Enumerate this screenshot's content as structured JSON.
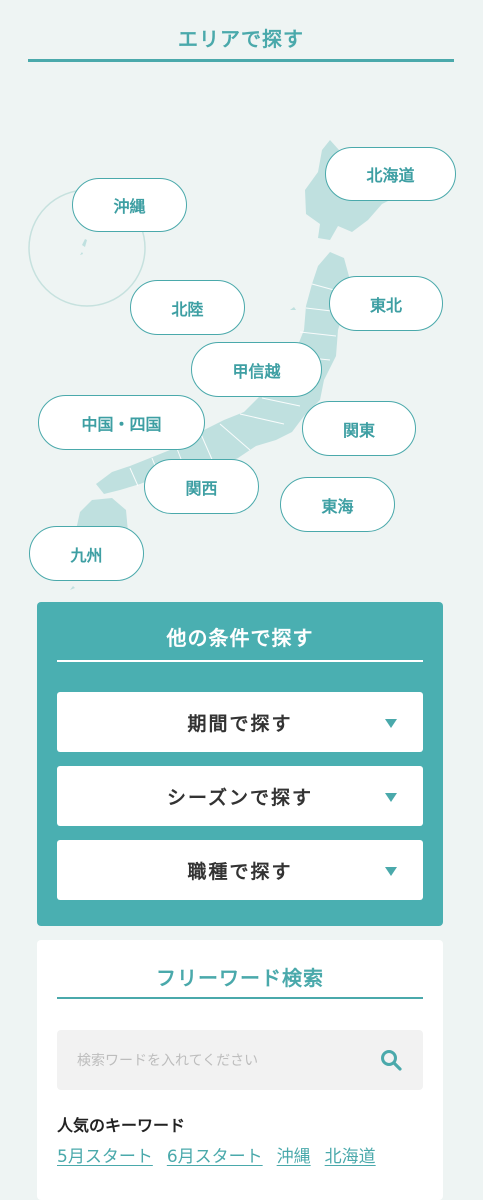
{
  "area": {
    "title": "エリアで探す",
    "regions": {
      "okinawa": "沖縄",
      "hokkaido": "北海道",
      "hokuriku": "北陸",
      "tohoku": "東北",
      "koshinetsu": "甲信越",
      "chugoku_shikoku": "中国・四国",
      "kanto": "関東",
      "kansai": "関西",
      "tokai": "東海",
      "kyushu": "九州"
    }
  },
  "conditions": {
    "title": "他の条件で探す",
    "period": "期間で探す",
    "season": "シーズンで探す",
    "job": "職種で探す"
  },
  "freeword": {
    "title": "フリーワード検索",
    "placeholder": "検索ワードを入れてください",
    "popular_title": "人気のキーワード",
    "keywords": [
      "5月スタート",
      "6月スタート",
      "沖縄",
      "北海道"
    ]
  },
  "colors": {
    "accent": "#4aa9ab",
    "map_fill": "#bfe0df",
    "background": "#eef4f3"
  }
}
